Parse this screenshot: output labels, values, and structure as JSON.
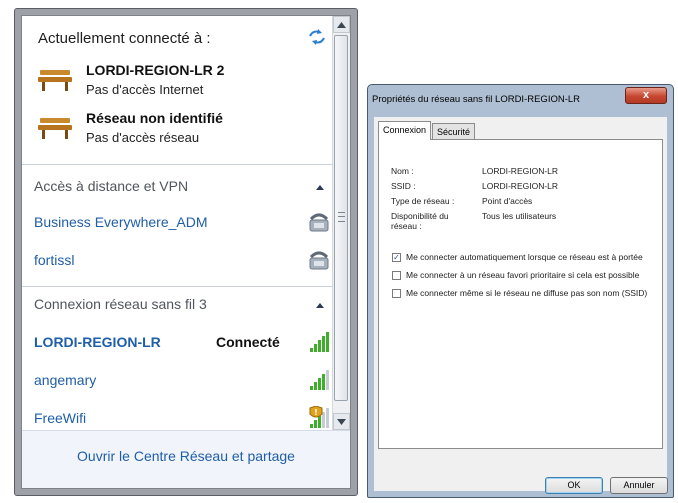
{
  "flyout": {
    "connected_header": "Actuellement connecté à :",
    "connections": [
      {
        "name": "LORDI-REGION-LR  2",
        "status": "Pas d'accès Internet",
        "icon": "network-bench-icon"
      },
      {
        "name": "Réseau non identifié",
        "status": "Pas d'accès réseau",
        "icon": "network-bench-icon"
      }
    ],
    "vpn_section": {
      "title": "Accès à distance et VPN",
      "items": [
        {
          "name": "Business Everywhere_ADM",
          "icon": "modem-phone-icon"
        },
        {
          "name": "fortissl",
          "icon": "modem-phone-icon"
        }
      ]
    },
    "wifi_section": {
      "title": "Connexion réseau sans fil 3",
      "items": [
        {
          "name": "LORDI-REGION-LR",
          "status": "Connecté",
          "signal_bars": 5,
          "secured": false
        },
        {
          "name": "angemary",
          "status": "",
          "signal_bars": 4,
          "secured": false
        },
        {
          "name": "FreeWifi",
          "status": "",
          "signal_bars": 3,
          "secured": true
        }
      ]
    },
    "footer_link": "Ouvrir le Centre Réseau et partage"
  },
  "dialog": {
    "title": "Propriétés du réseau sans fil LORDI-REGION-LR",
    "close_label": "x",
    "tabs": [
      "Connexion",
      "Sécurité"
    ],
    "active_tab": "Connexion",
    "properties": [
      {
        "label": "Nom :",
        "value": "LORDI-REGION-LR"
      },
      {
        "label": "SSID :",
        "value": "LORDI-REGION-LR"
      },
      {
        "label": "Type de réseau :",
        "value": "Point d'accès"
      },
      {
        "label": "Disponibilité du réseau :",
        "value": "Tous les utilisateurs"
      }
    ],
    "checkboxes": [
      {
        "label": "Me connecter automatiquement lorsque ce réseau est à portée",
        "checked": true
      },
      {
        "label": "Me connecter à un réseau favori prioritaire si cela est possible",
        "checked": false
      },
      {
        "label": "Me connecter même si le réseau ne diffuse pas son nom (SSID)",
        "checked": false
      }
    ],
    "buttons": {
      "ok": "OK",
      "cancel": "Annuler"
    }
  },
  "colors": {
    "link_blue": "#1f5ea8",
    "signal_green": "#3fae2a",
    "dialog_frame": "#aebfd3"
  }
}
